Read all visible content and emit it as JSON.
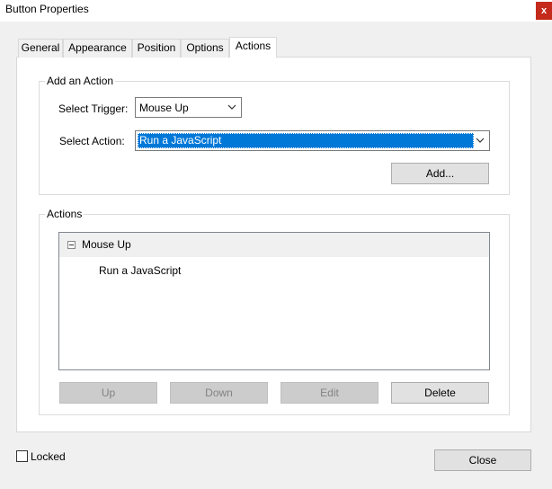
{
  "window": {
    "title": "Button Properties",
    "close_label": "x"
  },
  "tabs": [
    {
      "label": "General"
    },
    {
      "label": "Appearance"
    },
    {
      "label": "Position"
    },
    {
      "label": "Options"
    },
    {
      "label": "Actions",
      "selected": true
    }
  ],
  "add_action": {
    "legend": "Add an Action",
    "trigger_label": "Select Trigger:",
    "trigger_value": "Mouse Up",
    "action_label": "Select Action:",
    "action_value": "Run a JavaScript",
    "add_button": "Add..."
  },
  "actions": {
    "legend": "Actions",
    "tree": [
      {
        "trigger": "Mouse Up",
        "expanded": true,
        "items": [
          "Run a JavaScript"
        ]
      }
    ],
    "buttons": {
      "up": "Up",
      "down": "Down",
      "edit": "Edit",
      "delete": "Delete"
    }
  },
  "footer": {
    "locked_label": "Locked",
    "locked_checked": false,
    "close_button": "Close"
  },
  "colors": {
    "selection": "#0078d7",
    "close": "#c42b1c"
  }
}
